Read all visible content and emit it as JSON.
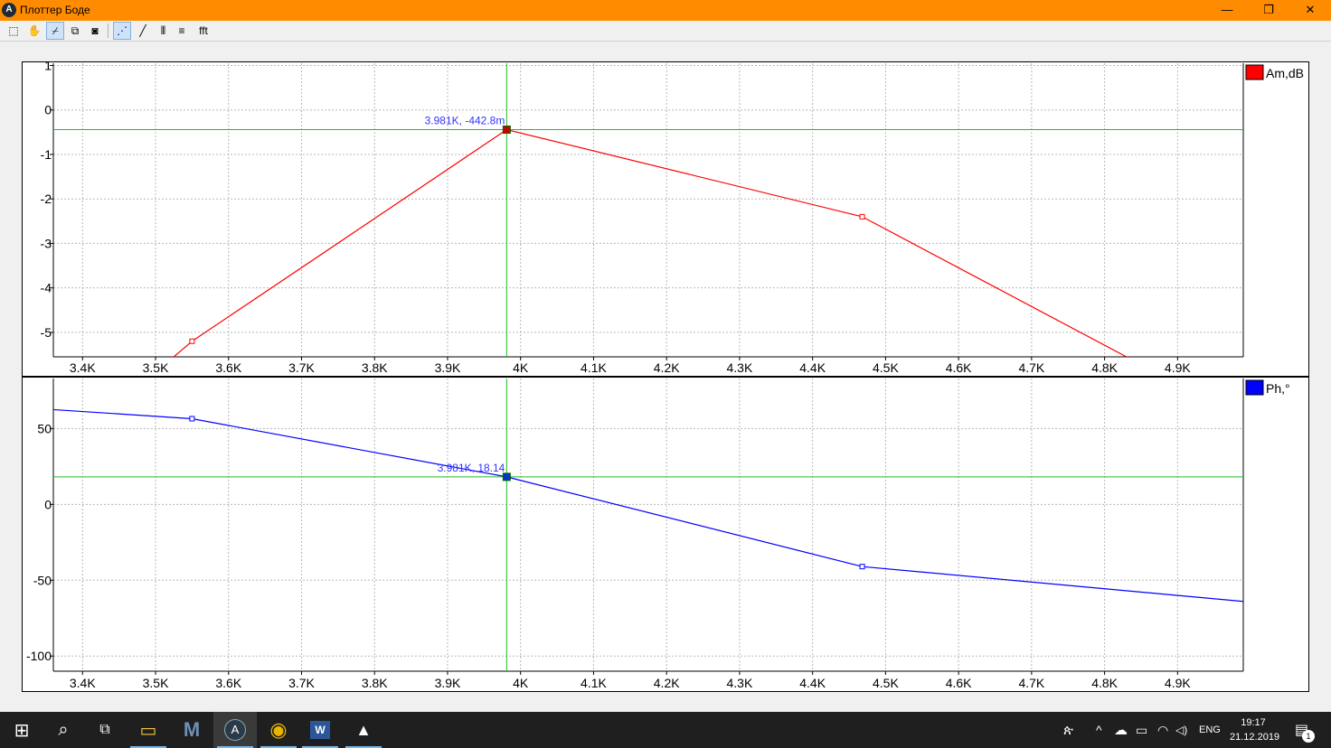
{
  "window": {
    "title": "Плоттер Боде",
    "icon_letter": "A",
    "minimize_glyph": "—",
    "maximize_glyph": "❐",
    "close_glyph": "✕"
  },
  "toolbar": {
    "items": [
      {
        "name": "select-zoom-icon",
        "glyph": "⬚"
      },
      {
        "name": "hand-pan-icon",
        "glyph": "✋"
      },
      {
        "name": "cursor-toggle-icon",
        "glyph": "⌿"
      },
      {
        "name": "copy-icon",
        "glyph": "⧉"
      },
      {
        "name": "snapshot-icon",
        "glyph": "◙"
      },
      {
        "name": "points-mode-icon",
        "glyph": "⋰"
      },
      {
        "name": "line-mode-icon",
        "glyph": "╱"
      },
      {
        "name": "vertical-grid-icon",
        "glyph": "|||"
      },
      {
        "name": "horizontal-grid-icon",
        "glyph": "≡"
      }
    ],
    "fft_label": "fft"
  },
  "chart_data": [
    {
      "type": "line",
      "series": [
        {
          "name": "Am,dB",
          "color": "#ff0000",
          "points": [
            [
              3500,
              -5.9
            ],
            [
              3550,
              -5.2
            ],
            [
              3981,
              -0.4428
            ],
            [
              4468,
              -2.4
            ],
            [
              4830,
              -5.55
            ]
          ]
        }
      ],
      "xlim": [
        3360,
        4990
      ],
      "ylim": [
        -5.55,
        1.05
      ],
      "xticks": [
        3400,
        3500,
        3600,
        3700,
        3800,
        3900,
        4000,
        4100,
        4200,
        4300,
        4400,
        4500,
        4600,
        4700,
        4800,
        4900
      ],
      "xtick_labels": [
        "3.4K",
        "3.5K",
        "3.6K",
        "3.7K",
        "3.8K",
        "3.9K",
        "4K",
        "4.1K",
        "4.2K",
        "4.3K",
        "4.4K",
        "4.5K",
        "4.6K",
        "4.7K",
        "4.8K",
        "4.9K"
      ],
      "yticks": [
        1,
        0,
        -1,
        -2,
        -3,
        -4,
        -5
      ],
      "ytick_labels": [
        "1",
        "0",
        "-1",
        "-2",
        "-3",
        "-4",
        "-5"
      ],
      "marker_x": [
        3550,
        4468
      ],
      "cursor": {
        "x": 3981,
        "y": -0.4428,
        "label": "3.981K, -442.8m"
      },
      "grid": true,
      "legend": "top-right"
    },
    {
      "type": "line",
      "series": [
        {
          "name": "Ph,°",
          "color": "#0000ff",
          "points": [
            [
              3360,
              62.5
            ],
            [
              3550,
              56.5
            ],
            [
              3981,
              18.14
            ],
            [
              4468,
              -41
            ],
            [
              4990,
              -64
            ]
          ]
        }
      ],
      "xlim": [
        3360,
        4990
      ],
      "ylim": [
        -110,
        83
      ],
      "xticks": [
        3400,
        3500,
        3600,
        3700,
        3800,
        3900,
        4000,
        4100,
        4200,
        4300,
        4400,
        4500,
        4600,
        4700,
        4800,
        4900
      ],
      "xtick_labels": [
        "3.4K",
        "3.5K",
        "3.6K",
        "3.7K",
        "3.8K",
        "3.9K",
        "4K",
        "4.1K",
        "4.2K",
        "4.3K",
        "4.4K",
        "4.5K",
        "4.6K",
        "4.7K",
        "4.8K",
        "4.9K"
      ],
      "yticks": [
        50,
        0,
        -50,
        -100
      ],
      "ytick_labels": [
        "50",
        "0",
        "-50",
        "-100"
      ],
      "marker_x": [
        3550,
        4468
      ],
      "cursor": {
        "x": 3981,
        "y": 18.14,
        "label": "3.981K, 18.14"
      },
      "grid": true,
      "legend": "top-right"
    }
  ],
  "taskbar": {
    "apps": [
      {
        "name": "windows-start-icon",
        "glyph": "⊞"
      },
      {
        "name": "search-icon",
        "glyph": "⌕"
      },
      {
        "name": "task-view-icon",
        "glyph": "⧉"
      },
      {
        "name": "file-explorer-icon",
        "glyph": "▭"
      },
      {
        "name": "mathcad-icon",
        "glyph": "M"
      },
      {
        "name": "bode-app-icon",
        "glyph": "A"
      },
      {
        "name": "chrome-icon",
        "glyph": "◉"
      },
      {
        "name": "word-icon",
        "glyph": "W"
      },
      {
        "name": "photos-icon",
        "glyph": "▲"
      }
    ],
    "tray": {
      "people_glyph": "ጵ",
      "chevron_glyph": "^",
      "cloud_glyph": "☁",
      "battery_glyph": "▭",
      "wifi_glyph": "◠",
      "volume_glyph": "◁)",
      "language": "ENG",
      "time": "19:17",
      "date": "21.12.2019",
      "notification_glyph": "▤",
      "notification_count": "1"
    }
  }
}
